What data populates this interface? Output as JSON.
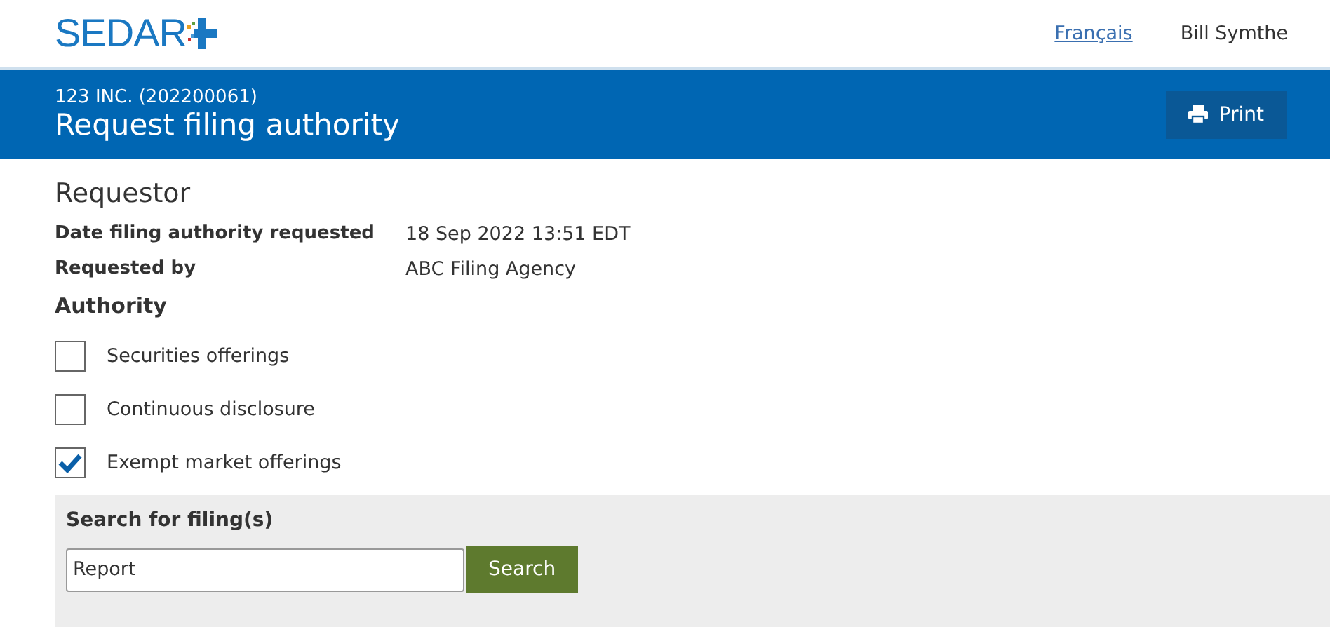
{
  "logo": {
    "text": "SEDAR"
  },
  "top_nav": {
    "language_link": "Français",
    "user_name": "Bill Symthe"
  },
  "banner": {
    "subtitle": "123 INC. (202200061)",
    "title": "Request filing authority",
    "print_button": "Print"
  },
  "section_title": "Requestor",
  "details": [
    {
      "label": "Date filing authority requested",
      "value": "18 Sep 2022 13:51 EDT"
    },
    {
      "label": "Requested by",
      "value": "ABC Filing Agency"
    }
  ],
  "authority": {
    "heading": "Authority",
    "options": [
      {
        "label": "Securities offerings",
        "checked": false
      },
      {
        "label": "Continuous disclosure",
        "checked": false
      },
      {
        "label": "Exempt market offerings",
        "checked": true
      }
    ]
  },
  "search_panel": {
    "heading": "Search for filing(s)",
    "value": "Report",
    "button": "Search"
  }
}
